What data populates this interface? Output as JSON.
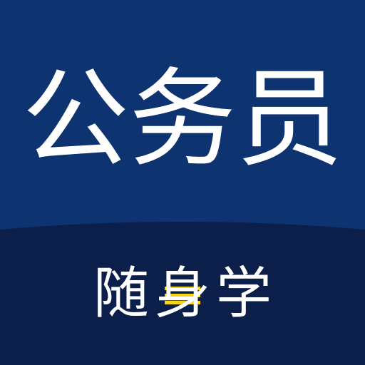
{
  "icon": {
    "title": "公务员",
    "subtitle_part1": "随",
    "subtitle_highlight": "身",
    "subtitle_part2": "学",
    "colors": {
      "top_background": "#0d3370",
      "bottom_background": "#0b1f4a",
      "text": "#ffffff",
      "accent": "#f5d41a"
    }
  }
}
